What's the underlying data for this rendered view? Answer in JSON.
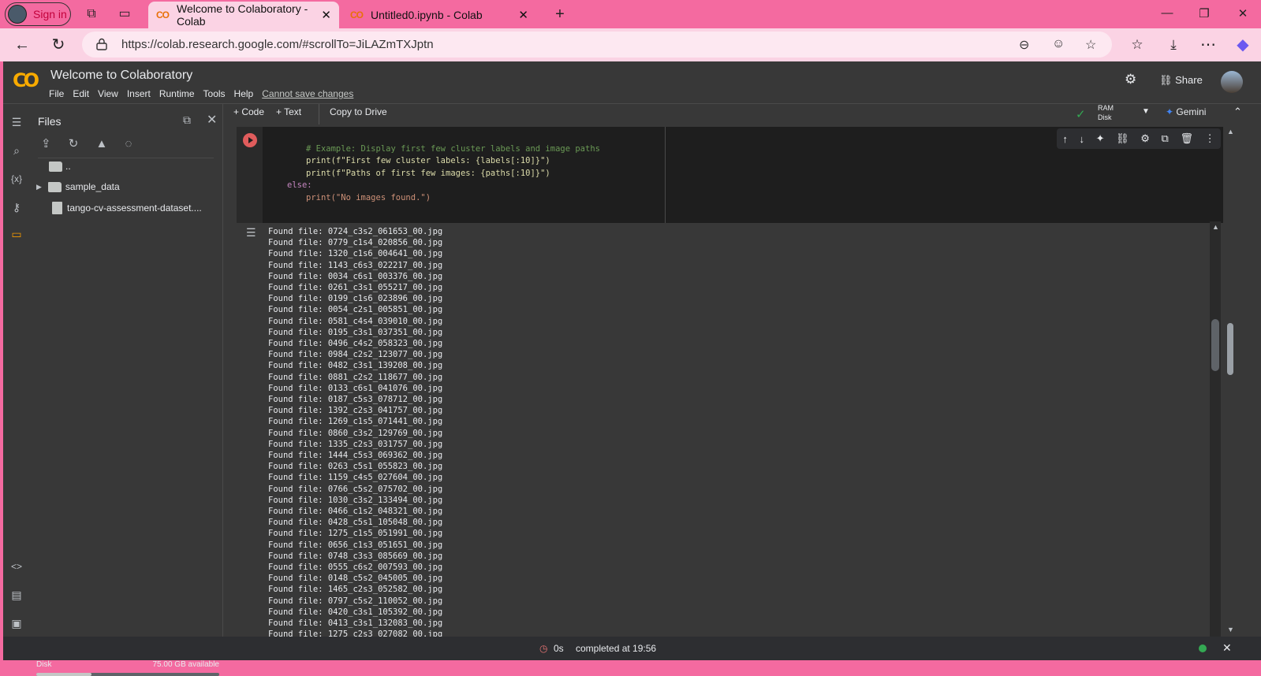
{
  "browser": {
    "signin_label": "Sign in",
    "tabs": [
      {
        "title": "Welcome to Colaboratory - Colab",
        "active": true
      },
      {
        "title": "Untitled0.ipynb - Colab",
        "active": false
      }
    ],
    "url": "https://colab.research.google.com/#scrollTo=JiLAZmTXJptn"
  },
  "colab": {
    "logo_text": "CO",
    "notebook_title": "Welcome to Colaboratory",
    "menu": [
      "File",
      "Edit",
      "View",
      "Insert",
      "Runtime",
      "Tools",
      "Help"
    ],
    "menu_warning": "Cannot save changes",
    "share_label": "Share",
    "toolbar": {
      "code_label": "+ Code",
      "text_label": "+ Text",
      "copy_drive_label": "Copy to Drive",
      "ram_label": "RAM",
      "disk_label": "Disk",
      "gemini_label": "Gemini"
    },
    "files_panel": {
      "title": "Files",
      "tree": [
        {
          "label": "..",
          "type": "parent"
        },
        {
          "label": "sample_data",
          "type": "folder"
        },
        {
          "label": "tango-cv-assessment-dataset....",
          "type": "file"
        }
      ],
      "disk_label": "Disk",
      "disk_available": "75.00 GB available",
      "disk_used_fraction": 0.3
    },
    "code_lines": [
      "# Example: Display first few cluster labels and image paths",
      "print(f\"First few cluster labels: {labels[:10]}\")",
      "print(f\"Paths of first few images: {paths[:10]}\")",
      "else:",
      "print(\"No images found.\")"
    ],
    "output_lines": [
      "Found file: 0724_c3s2_061653_00.jpg",
      "Found file: 0779_c1s4_020856_00.jpg",
      "Found file: 1320_c1s6_004641_00.jpg",
      "Found file: 1143_c6s3_022217_00.jpg",
      "Found file: 0034_c6s1_003376_00.jpg",
      "Found file: 0261_c3s1_055217_00.jpg",
      "Found file: 0199_c1s6_023896_00.jpg",
      "Found file: 0054_c2s1_005851_00.jpg",
      "Found file: 0581_c4s4_039010_00.jpg",
      "Found file: 0195_c3s1_037351_00.jpg",
      "Found file: 0496_c4s2_058323_00.jpg",
      "Found file: 0984_c2s2_123077_00.jpg",
      "Found file: 0482_c3s1_139208_00.jpg",
      "Found file: 0881_c2s2_118677_00.jpg",
      "Found file: 0133_c6s1_041076_00.jpg",
      "Found file: 0187_c5s3_078712_00.jpg",
      "Found file: 1392_c2s3_041757_00.jpg",
      "Found file: 1269_c1s5_071441_00.jpg",
      "Found file: 0860_c3s2_129769_00.jpg",
      "Found file: 1335_c2s3_031757_00.jpg",
      "Found file: 1444_c5s3_069362_00.jpg",
      "Found file: 0263_c5s1_055823_00.jpg",
      "Found file: 1159_c4s5_027604_00.jpg",
      "Found file: 0766_c5s2_075702_00.jpg",
      "Found file: 1030_c3s2_133494_00.jpg",
      "Found file: 0466_c1s2_048321_00.jpg",
      "Found file: 0428_c5s1_105048_00.jpg",
      "Found file: 1275_c1s5_051991_00.jpg",
      "Found file: 0656_c1s3_051651_00.jpg",
      "Found file: 0748_c3s3_085669_00.jpg",
      "Found file: 0555_c6s2_007593_00.jpg",
      "Found file: 0148_c5s2_045005_00.jpg",
      "Found file: 1465_c2s3_052582_00.jpg",
      "Found file: 0797_c5s2_110052_00.jpg",
      "Found file: 0420_c3s1_105392_00.jpg",
      "Found file: 0413_c3s1_132083_00.jpg",
      "Found file: 1275_c2s3_027082_00.jpg"
    ],
    "status": {
      "duration": "0s",
      "completed": "completed at 19:56"
    }
  },
  "colors": {
    "browser_bg": "#f46aa0",
    "colab_bg": "#383838",
    "accent": "#f9ab00"
  }
}
